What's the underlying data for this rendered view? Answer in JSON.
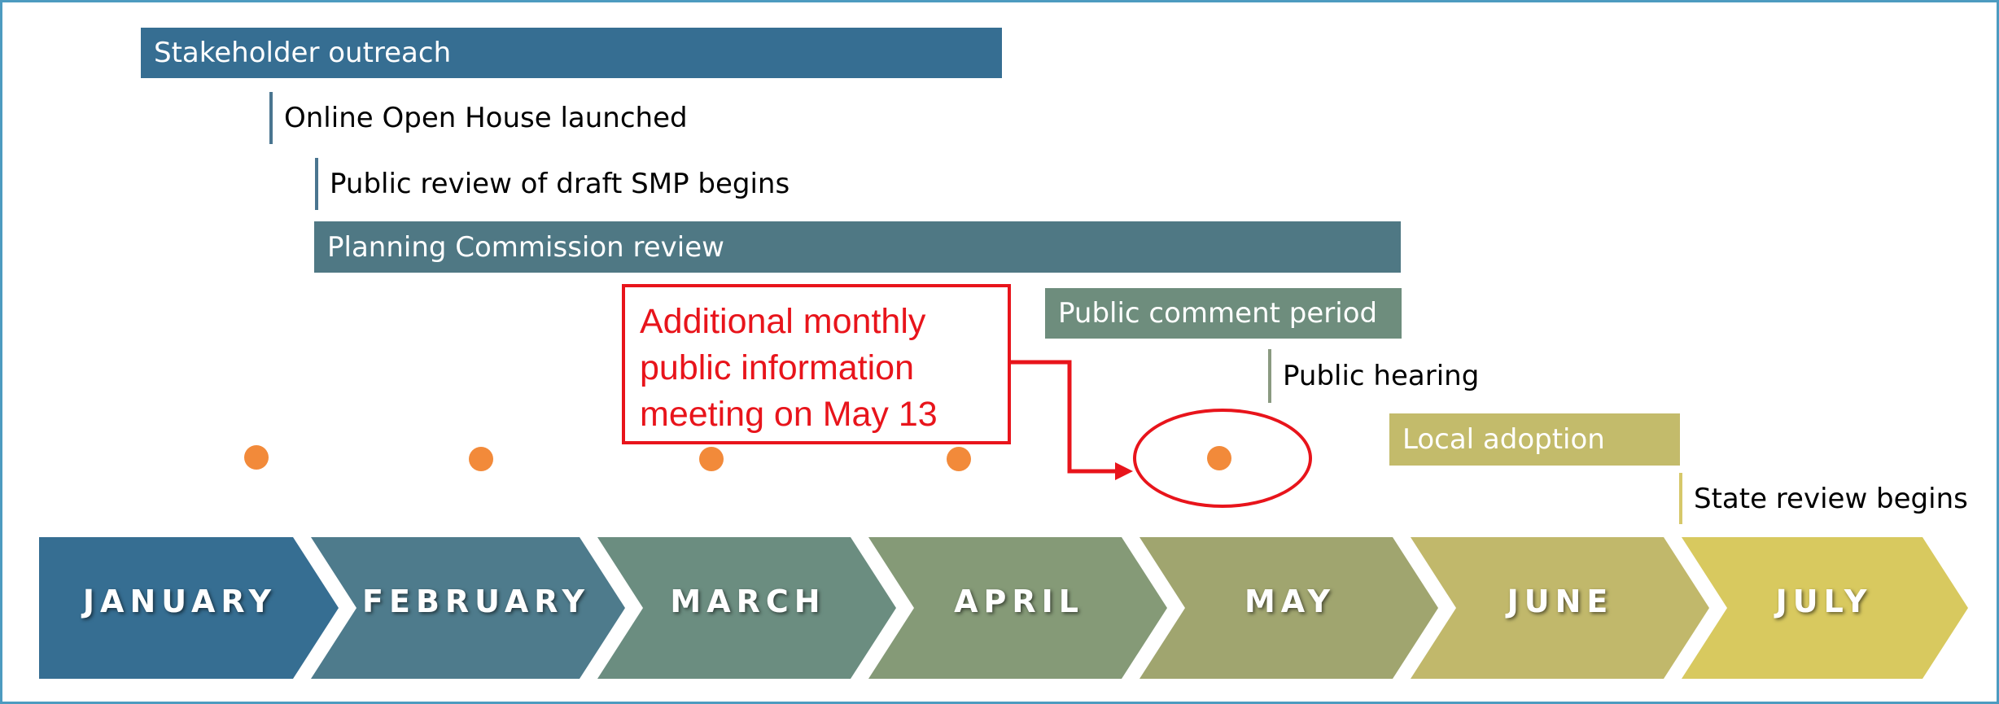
{
  "colors": {
    "frame": "#4d9bc0",
    "dot": "#f28a3a",
    "callout": "#e8141b"
  },
  "tasks": [
    {
      "id": "stakeholder",
      "label": "Stakeholder outreach",
      "type": "bar",
      "color": "#366e92"
    },
    {
      "id": "open-house",
      "label": "Online Open House launched",
      "type": "milestone",
      "color": "#4a7590"
    },
    {
      "id": "public-review",
      "label": "Public review of draft SMP begins",
      "type": "milestone",
      "color": "#4a7590"
    },
    {
      "id": "planning",
      "label": "Planning Commission review",
      "type": "bar",
      "color": "#4f7884"
    },
    {
      "id": "comment",
      "label": "Public comment period",
      "type": "bar",
      "color": "#6e8d7d"
    },
    {
      "id": "hearing",
      "label": "Public hearing",
      "type": "milestone",
      "color": "#8a9a80"
    },
    {
      "id": "adoption",
      "label": "Local adoption",
      "type": "bar",
      "color": "#c3bb6b"
    },
    {
      "id": "state-review",
      "label": "State review begins",
      "type": "milestone",
      "color": "#d6c86a"
    }
  ],
  "meeting_dots": [
    "January",
    "February",
    "March",
    "April",
    "May"
  ],
  "callout": {
    "lines": [
      "Additional monthly",
      "public information",
      "meeting on May 13"
    ]
  },
  "months": [
    {
      "label": "JANUARY",
      "color": "#366e92"
    },
    {
      "label": "FEBRUARY",
      "color": "#4e7b8c"
    },
    {
      "label": "MARCH",
      "color": "#6b8d80"
    },
    {
      "label": "APRIL",
      "color": "#859a77"
    },
    {
      "label": "MAY",
      "color": "#a0a56f"
    },
    {
      "label": "JUNE",
      "color": "#c1b86b"
    },
    {
      "label": "JULY",
      "color": "#d8c95f"
    }
  ]
}
